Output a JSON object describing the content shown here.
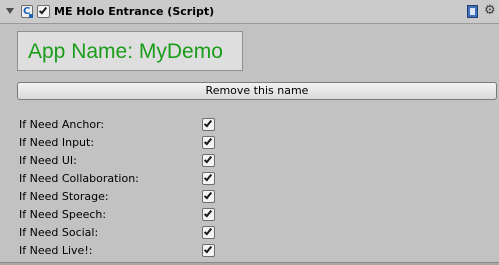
{
  "component": {
    "title": "ME Holo Entrance (Script)",
    "enabled": true,
    "icons": {
      "foldout": "foldout-arrow-icon",
      "script": "csharp-script-icon",
      "help": "help-book-icon",
      "settings": "gear-icon"
    }
  },
  "app_name_label": "App Name: MyDemo",
  "remove_button_label": "Remove this name",
  "options": [
    {
      "label": "If Need Anchor:",
      "checked": true
    },
    {
      "label": "If Need Input:",
      "checked": true
    },
    {
      "label": "If Need UI:",
      "checked": true
    },
    {
      "label": "If Need Collaboration:",
      "checked": true
    },
    {
      "label": "If Need Storage:",
      "checked": true
    },
    {
      "label": "If Need Speech:",
      "checked": true
    },
    {
      "label": "If Need Social:",
      "checked": true
    },
    {
      "label": "If Need Live!:",
      "checked": true
    }
  ],
  "colors": {
    "app_name_text": "#1a9d1a",
    "panel_background": "#c2c2c2"
  }
}
